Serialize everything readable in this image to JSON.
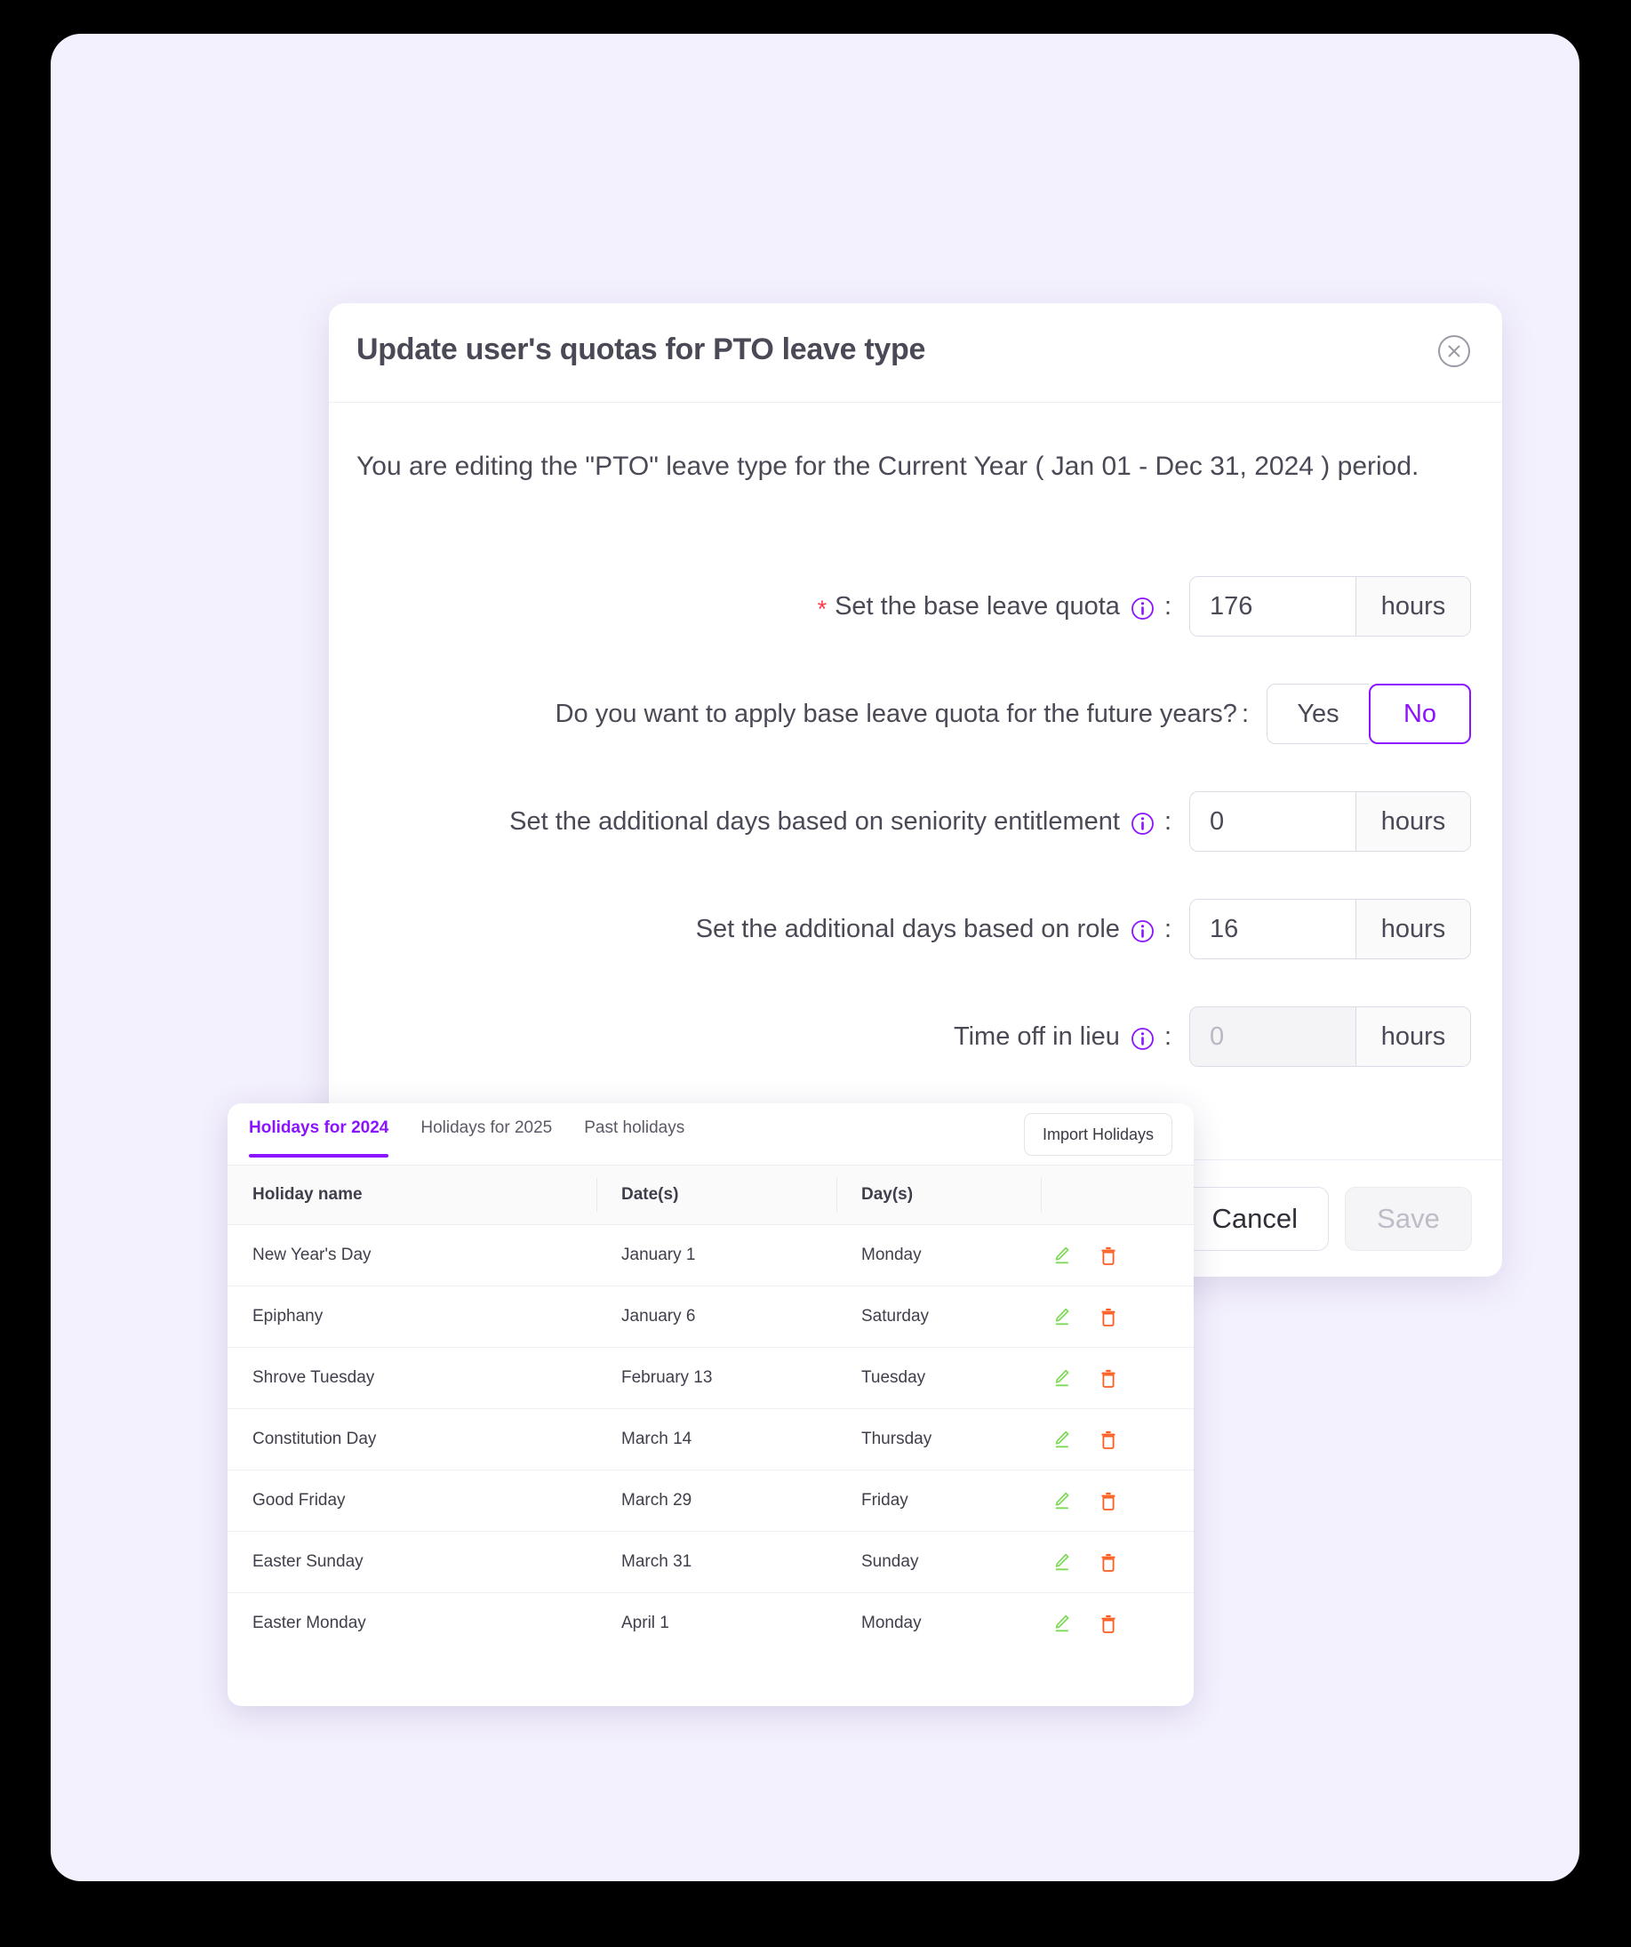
{
  "modal": {
    "title": "Update user's quotas for PTO leave type",
    "close_label": "close",
    "intro": "You are editing the \"PTO\" leave type for the Current Year ( Jan 01 - Dec 31, 2024 ) period.",
    "rows": {
      "base_quota": {
        "required_marker": "*",
        "label": "Set the base leave quota",
        "colon": ":",
        "value": "176",
        "suffix": "hours"
      },
      "future_years": {
        "label": "Do you want to apply base leave quota for the future years?",
        "colon": ":",
        "options": [
          "Yes",
          "No"
        ],
        "yes_label": "Yes",
        "no_label": "No",
        "selected": "No"
      },
      "seniority": {
        "label": "Set the additional days based on seniority entitlement",
        "colon": ":",
        "value": "0",
        "suffix": "hours"
      },
      "role": {
        "label": "Set the additional days based on role",
        "colon": ":",
        "value": "16",
        "suffix": "hours"
      },
      "time_off_in_lieu": {
        "label": "Time off in lieu",
        "colon": ":",
        "value": "0",
        "suffix": "hours",
        "disabled": true
      }
    },
    "footer": {
      "cancel_label": "Cancel",
      "save_label": "Save",
      "save_disabled": true
    }
  },
  "holidays": {
    "tabs": [
      {
        "label": "Holidays for 2024",
        "active": true
      },
      {
        "label": "Holidays for 2025",
        "active": false
      },
      {
        "label": "Past holidays",
        "active": false
      }
    ],
    "import_label": "Import Holidays",
    "columns": [
      "Holiday name",
      "Date(s)",
      "Day(s)",
      ""
    ],
    "rows": [
      {
        "name": "New Year's Day",
        "date": "January 1",
        "day": "Monday"
      },
      {
        "name": "Epiphany",
        "date": "January 6",
        "day": "Saturday"
      },
      {
        "name": "Shrove Tuesday",
        "date": "February 13",
        "day": "Tuesday"
      },
      {
        "name": "Constitution Day",
        "date": "March 14",
        "day": "Thursday"
      },
      {
        "name": "Good Friday",
        "date": "March 29",
        "day": "Friday"
      },
      {
        "name": "Easter Sunday",
        "date": "March 31",
        "day": "Sunday"
      },
      {
        "name": "Easter Monday",
        "date": "April 1",
        "day": "Monday"
      }
    ]
  },
  "colors": {
    "accent_purple": "#8B13FF",
    "page_background": "#F4F1FE",
    "required_red": "#FF3B47",
    "edit_green": "#7ED957",
    "delete_orange": "#FF5C1F",
    "text_primary": "#4A4A57"
  }
}
